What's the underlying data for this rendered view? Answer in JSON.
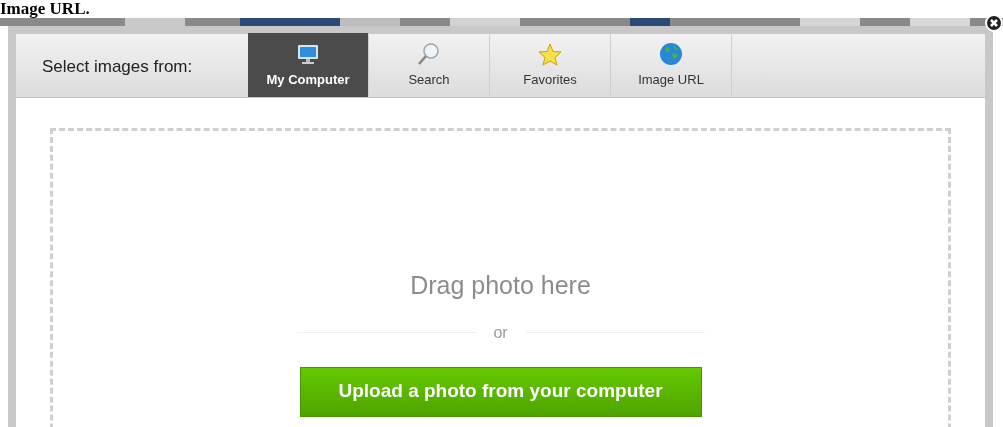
{
  "heading": "Image URL.",
  "dialog": {
    "label": "Select images from:",
    "tabs": [
      {
        "label": "My Computer",
        "selected": true
      },
      {
        "label": "Search",
        "selected": false
      },
      {
        "label": "Favorites",
        "selected": false
      },
      {
        "label": "Image URL",
        "selected": false
      }
    ],
    "drop_text": "Drag photo here",
    "separator": "or",
    "upload_button": "Upload a photo from your computer"
  }
}
